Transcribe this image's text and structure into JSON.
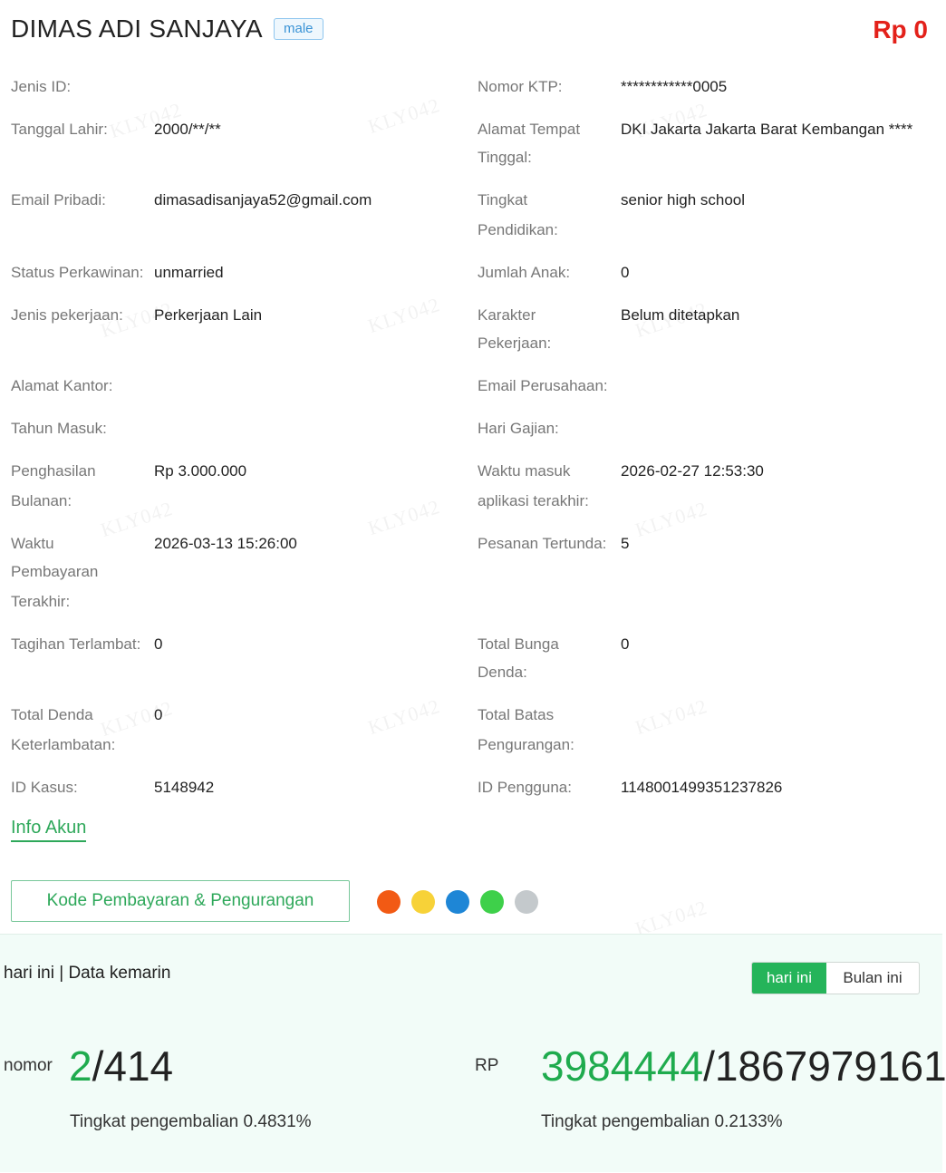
{
  "header": {
    "name": "DIMAS ADI SANJAYA",
    "gender": "male",
    "amount": "Rp 0"
  },
  "fields": {
    "jenis_id": {
      "label": "Jenis ID:",
      "value": ""
    },
    "nomor_ktp": {
      "label": "Nomor KTP:",
      "value": "************0005"
    },
    "tanggal_lahir": {
      "label": "Tanggal Lahir:",
      "value": "2000/**/**"
    },
    "alamat_tempat_tinggal": {
      "label_1": "Alamat Tempat",
      "label_2": "Tinggal:",
      "value": "DKI Jakarta Jakarta Barat Kembangan ****"
    },
    "email_pribadi": {
      "label": "Email Pribadi:",
      "value": "dimasadisanjaya52@gmail.com"
    },
    "tingkat_pendidikan": {
      "label_1": "Tingkat",
      "label_2": "Pendidikan:",
      "value": "senior high school"
    },
    "status_perkawinan": {
      "label": "Status Perkawinan:",
      "value": "unmarried"
    },
    "jumlah_anak": {
      "label": "Jumlah Anak:",
      "value": "0"
    },
    "jenis_pekerjaan": {
      "label": "Jenis pekerjaan:",
      "value": "Perkerjaan Lain"
    },
    "karakter_pekerjaan": {
      "label_1": "Karakter",
      "label_2": "Pekerjaan:",
      "value": "Belum ditetapkan"
    },
    "alamat_kantor": {
      "label": "Alamat Kantor:",
      "value": ""
    },
    "email_perusahaan": {
      "label": "Email Perusahaan:",
      "value": ""
    },
    "tahun_masuk": {
      "label": "Tahun Masuk:",
      "value": ""
    },
    "hari_gajian": {
      "label": "Hari Gajian:",
      "value": ""
    },
    "penghasilan_bulanan": {
      "label_1": "Penghasilan",
      "label_2": "Bulanan:",
      "value": "Rp 3.000.000"
    },
    "waktu_masuk_aplikasi": {
      "label_1": "Waktu masuk",
      "label_2": "aplikasi terakhir:",
      "value": "2026-02-27 12:53:30"
    },
    "waktu_pembayaran_terakhir": {
      "label_1": "Waktu",
      "label_2": "Pembayaran",
      "label_3": "Terakhir:",
      "value": "2026-03-13 15:26:00"
    },
    "pesanan_tertunda": {
      "label": "Pesanan Tertunda:",
      "value": "5"
    },
    "tagihan_terlambat": {
      "label": "Tagihan Terlambat:",
      "value": "0"
    },
    "total_bunga_denda": {
      "label_1": "Total Bunga",
      "label_2": "Denda:",
      "value": "0"
    },
    "total_denda_keterlambatan": {
      "label_1": "Total Denda",
      "label_2": "Keterlambatan:",
      "value": "0"
    },
    "total_batas_pengurangan": {
      "label_1": "Total Batas",
      "label_2": "Pengurangan:",
      "value": ""
    },
    "id_kasus": {
      "label": "ID Kasus:",
      "value": "5148942"
    },
    "id_pengguna": {
      "label": "ID Pengguna:",
      "value": "1148001499351237826"
    }
  },
  "actions": {
    "info_akun": "Info Akun",
    "kode_button": "Kode Pembayaran & Pengurangan"
  },
  "status_dots": {
    "colors": [
      "#f25a14",
      "#f7d238",
      "#1e86d6",
      "#3ed04a",
      "#c4c9cc"
    ]
  },
  "stats": {
    "title": "hari ini | Data kemarin",
    "toggle": {
      "active": "hari ini",
      "inactive": "Bulan ini"
    },
    "count": {
      "label": "nomor",
      "highlight": "2",
      "total": "/414",
      "rate": "Tingkat pengembalian 0.4831%"
    },
    "money": {
      "label": "RP",
      "highlight": "3984444",
      "total": "/1867979161",
      "rate": "Tingkat pengembalian 0.2133%"
    }
  },
  "watermark": "KLY042",
  "colors": {
    "accent": "#2ea85a",
    "amount_red": "#e3211a",
    "badge_blue": "#3b94d6",
    "panel_bg": "#f2fcf8"
  }
}
